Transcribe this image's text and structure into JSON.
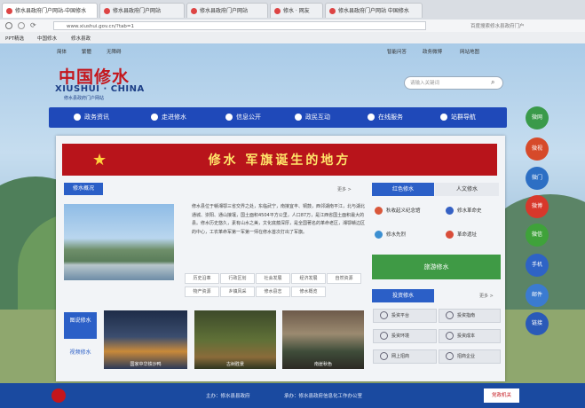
{
  "browser": {
    "tabs": [
      "修水县政府门户网站-中国修水",
      "修水县政府门户网站",
      "修水县政府门户网站",
      "修水 · 网友",
      "修水县政府门户网站 中国修水"
    ],
    "address": "www.xiushui.gov.cn/?tab=1",
    "bookmarks": [
      "PPT精选",
      "中国修水",
      "修水县政"
    ],
    "right_note": "百度搜索修水县政府门户"
  },
  "site": {
    "top_links": [
      "简体",
      "繁體",
      "无障碍",
      "智能问答",
      "政务微博",
      "网站地图"
    ],
    "logo_cn": "中国修水",
    "logo_en": "XIUSHUI · CHINA",
    "logo_sub": "修水县政府门户网站",
    "search_placeholder": "请输入关键词",
    "nav": [
      "政务资讯",
      "走进修水",
      "信息公开",
      "政民互动",
      "在线服务",
      "站群导航"
    ],
    "banner": "修水  军旗诞生的地方",
    "overview": {
      "heading": "修水概况",
      "more": "更多 >",
      "paragraph": "修水县位于赣湘鄂三省交界之处，东临武宁，南接宜丰、铜鼓，西邻湖南平江，北与湖北通城、崇阳、通山接壤，国土面积4504平方公里，人口87万，是江西省国土面积最大的县。修水历史悠久，素有山水之美，文化底蕴深厚，是全国著名的革命老区，湘鄂赣边区的中心，工农革命军第一军第一师在修水首次打出了军旗。",
      "tags": [
        "历史沿革",
        "行政区划",
        "社会发展",
        "经济发展",
        "自然资源",
        "物产资源",
        "乡镇风采",
        "修水县志",
        "修水概览"
      ],
      "left_tabs": [
        "图说修水",
        "视频修水"
      ],
      "thumbs": [
        "国家中华铁沙鸭",
        "古树胜景",
        "南崖秋色"
      ]
    },
    "right": {
      "tabs": [
        "红色修水",
        "人文修水"
      ],
      "items": [
        "秋收起义纪念馆",
        "修水革命史",
        "修水先烈",
        "革命遗址"
      ],
      "green_button": "旅游修水",
      "invest_heading": "投资修水",
      "invest_more": "更多 >",
      "invest_items": [
        "投资平台",
        "投资指南",
        "投资环境",
        "投资成本",
        "网上招商",
        "招商企业"
      ]
    },
    "side_circles": [
      {
        "label": "微网",
        "color": "#3a9a4a"
      },
      {
        "label": "微视",
        "color": "#d64a2a"
      },
      {
        "label": "微门",
        "color": "#2d6fc4"
      },
      {
        "label": "微博",
        "color": "#d8382b"
      },
      {
        "label": "微信",
        "color": "#3fa23a"
      },
      {
        "label": "手机",
        "color": "#2e63c5"
      },
      {
        "label": "邮件",
        "color": "#3b7bd0"
      },
      {
        "label": "链接",
        "color": "#2a5ab8"
      }
    ],
    "footer": {
      "left": "主办：修水县县政府",
      "middle": "承办：修水县政府信息化工作办公室",
      "badge": "党政机关"
    }
  }
}
